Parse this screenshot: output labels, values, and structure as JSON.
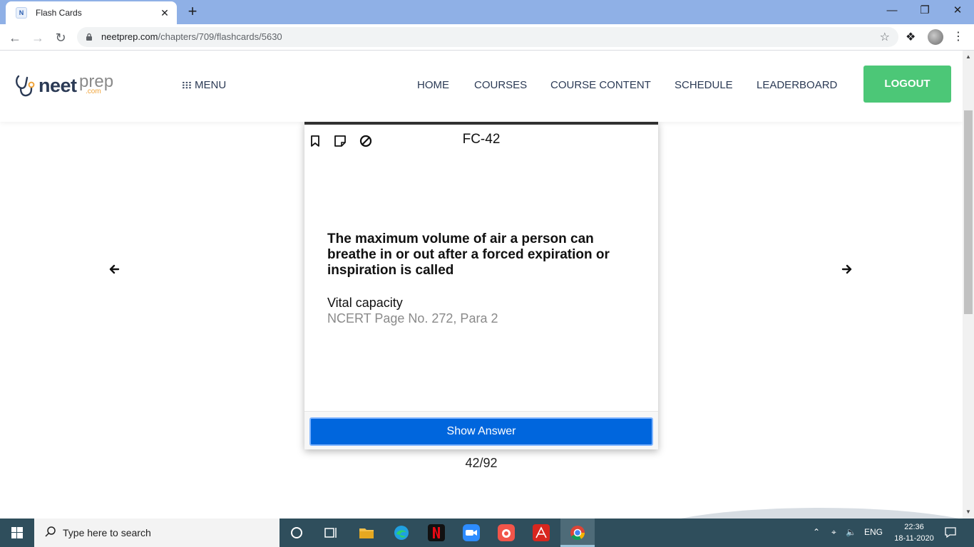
{
  "browser": {
    "tab_title": "Flash Cards",
    "favicon_text": "N",
    "url_domain": "neetprep.com",
    "url_path": "/chapters/709/flashcards/5630"
  },
  "header": {
    "logo_neet": "neet",
    "logo_prep": "prep",
    "logo_com": ".com",
    "menu_label": "MENU",
    "nav": {
      "home": "HOME",
      "courses": "COURSES",
      "course_content": "COURSE CONTENT",
      "schedule": "SCHEDULE",
      "leaderboard": "LEADERBOARD"
    },
    "logout_label": "LOGOUT"
  },
  "card": {
    "id_label": "FC-42",
    "question": "The maximum volume of air a person can breathe in or out after a forced expiration or inspiration is called",
    "answer": "Vital capacity",
    "reference": "NCERT Page No. 272, Para 2",
    "show_answer_label": "Show Answer"
  },
  "counter": "42/92",
  "taskbar": {
    "search_placeholder": "Type here to search",
    "language": "ENG",
    "time": "22:36",
    "date": "18-11-2020"
  },
  "colors": {
    "logout": "#4cc777",
    "show_answer": "#0066dd",
    "nav_text": "#2b3a55",
    "tabbar": "#8fb0e6",
    "taskbar": "#2f4e5c"
  },
  "icons": [
    "bookmark-icon",
    "note-icon",
    "block-icon",
    "arrow-left-icon",
    "arrow-right-icon",
    "grid-icon"
  ]
}
